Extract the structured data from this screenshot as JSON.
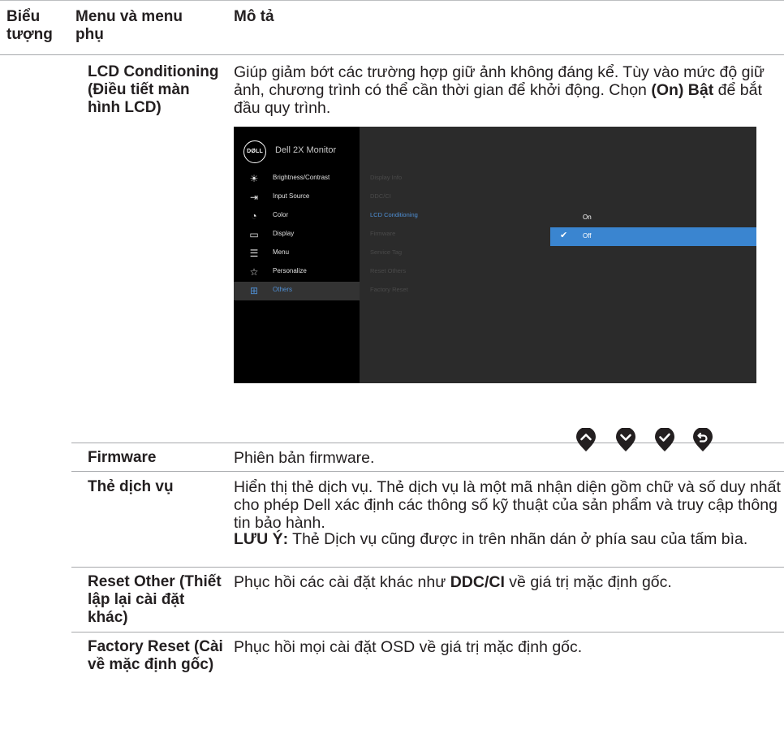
{
  "header": {
    "col_icon": "Biểu tượng",
    "col_menu": "Menu và menu phụ",
    "col_desc": "Mô tả"
  },
  "lcd": {
    "name": "LCD Conditioning (Điều tiết màn hình LCD)",
    "desc_pre": "Giúp giảm bớt các trường hợp giữ ảnh không đáng kể. Tùy vào mức độ giữ ảnh, chương trình có thể cần thời gian để khởi động. Chọn ",
    "desc_bold": "(On) Bật",
    "desc_post": " để bắt đầu quy trình."
  },
  "osd": {
    "logo": "DØLL",
    "title": "Dell 2X Monitor",
    "left_items": [
      {
        "label": "Brightness/Contrast",
        "icon": "brightness-icon"
      },
      {
        "label": "Input Source",
        "icon": "input-source-icon"
      },
      {
        "label": "Color",
        "icon": "color-icon"
      },
      {
        "label": "Display",
        "icon": "display-icon"
      },
      {
        "label": "Menu",
        "icon": "menu-icon"
      },
      {
        "label": "Personalize",
        "icon": "star-icon"
      },
      {
        "label": "Others",
        "icon": "others-icon"
      }
    ],
    "mid_items": [
      "Display Info",
      "DDC/CI",
      "LCD Conditioning",
      "Firmware",
      "Service Tag",
      "Reset Others",
      "Factory Reset"
    ],
    "right_items": [
      "On",
      "Off"
    ],
    "accent": "#3a85d0"
  },
  "nav_icons": [
    "up-icon",
    "down-icon",
    "check-icon",
    "back-icon"
  ],
  "rows": {
    "firmware": {
      "name": "Firmware",
      "desc": "Phiên bản firmware."
    },
    "service_tag": {
      "name": "Thẻ dịch vụ",
      "desc": "Hiển thị thẻ dịch vụ. Thẻ dịch vụ là một mã nhận diện gồm chữ và số duy nhất cho phép Dell xác định các thông số kỹ thuật của sản phẩm và truy cập thông tin bảo hành.",
      "note_label": "LƯU Ý:",
      "note_text": " Thẻ Dịch vụ cũng được in trên nhãn dán ở phía sau của tấm bìa."
    },
    "reset_other": {
      "name": "Reset Other (Thiết lập lại cài đặt khác)",
      "desc_pre": "Phục hồi các cài đặt khác như ",
      "desc_bold": "DDC/CI",
      "desc_post": " về giá trị mặc định gốc."
    },
    "factory_reset": {
      "name": "Factory Reset (Cài về mặc định gốc)",
      "desc": "Phục hồi mọi cài đặt OSD về giá trị mặc định gốc."
    }
  }
}
